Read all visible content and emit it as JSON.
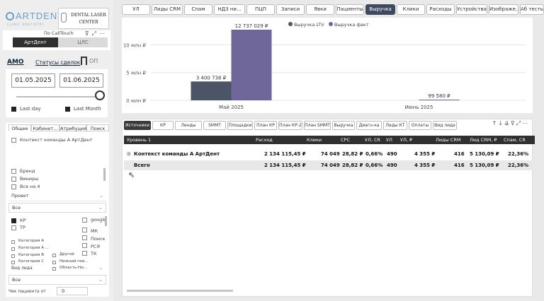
{
  "brand": {
    "logo_text": "ARTDENT",
    "logo_sub": "CLINIC DENTISTRY",
    "partner_logo": "DENTAL LASER CENTER"
  },
  "source_slicer": {
    "title": "По CallTouch",
    "options": [
      "АртДент",
      "ЦЛС"
    ],
    "selected": "АртДент"
  },
  "amo": {
    "label": "АМО",
    "status_link": "Статусы сделок",
    "toggle_label": "ОП"
  },
  "dates": {
    "from": "01.05.2025",
    "to": "01.06.2025",
    "last_day": "Last day",
    "last_month": "Last Month"
  },
  "filters": {
    "tabs": [
      "Общее",
      "Кабинет...",
      "Атрибуция",
      "Поиск"
    ],
    "campaign_item": "Контекст команды А АртДент",
    "items": [
      "Бренд",
      "Виниры",
      "Все на 4"
    ],
    "project_label": "Проект",
    "project_value": "Все",
    "project_options_left": [
      "КР",
      "ТР"
    ],
    "project_options_right": [
      "google",
      "МК",
      "Поиск",
      "РСЯ",
      "ТК"
    ],
    "categories": [
      "Категория А",
      "Категория А ...",
      "Категория В",
      "Категория С"
    ],
    "extra_options": [
      "Другой",
      "Нижний пов...",
      "Область-Ни..."
    ],
    "lead_type_label": "Вид лида",
    "lead_type_value": "Все",
    "check_label": "Чек пациента от",
    "check_value": "0"
  },
  "top_tabs": [
    "УЛ",
    "Лиды CRM",
    "Спам",
    "НДЗ ни...",
    "ПЦП",
    "Записи",
    "Явки",
    "Пациенты",
    "Выручка",
    "Клики",
    "Расходы",
    "Устройства",
    "Изображе...",
    "Аб тесты"
  ],
  "active_top_tab": "Выручка",
  "chart_data": {
    "type": "bar",
    "categories": [
      "Май 2025",
      "Июнь 2025"
    ],
    "series": [
      {
        "name": "Выручка LTV",
        "values": [
          3400738,
          0
        ],
        "color": "#4b5566"
      },
      {
        "name": "Выручка факт",
        "values": [
          12737029,
          99580
        ],
        "color": "#6f6699"
      }
    ],
    "data_labels": {
      "Выручка LTV": [
        "3 400 738 ₽",
        ""
      ],
      "Выручка факт": [
        "12 737 029 ₽",
        "99 580 ₽"
      ]
    },
    "y_ticks": [
      "0 млн ₽",
      "5 млн ₽",
      "10 млн ₽"
    ],
    "y_tick_values": [
      0,
      5000000,
      10000000
    ],
    "ylim": [
      0,
      13500000
    ],
    "legend": "top-center"
  },
  "sub_tabs": [
    "Источники",
    "КР",
    "Ленды",
    "SMMT",
    "Площадки",
    "План КР",
    "План КР-2",
    "План SMMT",
    "Выручка",
    "Диагн-ка",
    "Лиды КТ",
    "Оплаты",
    "Вид лида"
  ],
  "active_sub_tab": "Источники",
  "table": {
    "columns": [
      "Уровень 1",
      "Расход",
      "Клики",
      "CPC",
      "УЛ, CR",
      "УЛ",
      "УЛ, ₽",
      "Лиды CRM",
      "Лид CRM, ₽",
      "Спам, CR"
    ],
    "rows": [
      {
        "level": "Контекст команды А АртДент",
        "cells": [
          "2 134 115,45 ₽",
          "74 049",
          "28,82 ₽",
          "0,66%",
          "490",
          "4 355 ₽",
          "416",
          "5 130,09 ₽",
          "22,36%"
        ]
      },
      {
        "level": "Всего",
        "cells": [
          "2 134 115,45 ₽",
          "74 049",
          "28,82 ₽",
          "0,66%",
          "490",
          "4 355 ₽",
          "416",
          "5 130,09 ₽",
          "22,36%"
        ]
      }
    ]
  },
  "colors": {
    "accent_dark": "#3f4a5e",
    "ltv": "#4b5566",
    "fact": "#6f6699"
  }
}
